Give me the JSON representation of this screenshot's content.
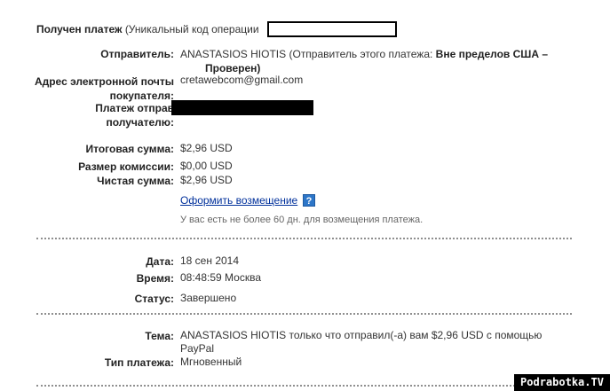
{
  "header": {
    "title_bold": "Получен платеж",
    "title_rest": "(Уникальный код операции"
  },
  "sender": {
    "label": "Отправитель:",
    "name": "ANASTASIOS HIOTIS",
    "status_prefix": "(Отправитель этого платежа:",
    "status_bold_line1": "Вне пределов США –",
    "status_bold_line2": "Проверен)"
  },
  "buyer_email": {
    "label_line1": "Адрес электронной почты",
    "label_line2": "покупателя:",
    "value": "cretawebcom@gmail.com"
  },
  "sent_to": {
    "label_line1": "Платеж отправ",
    "label_line2": "получателю:"
  },
  "amounts": {
    "total_label": "Итоговая сумма:",
    "total_value": "$2,96 USD",
    "fee_label": "Размер комиссии:",
    "fee_value": "$0,00 USD",
    "net_label": "Чистая сумма:",
    "net_value": "$2,96 USD"
  },
  "refund": {
    "link": "Оформить возмещение",
    "help_icon": "?",
    "note": "У вас есть не более 60 дн. для возмещения платежа."
  },
  "details": {
    "date_label": "Дата:",
    "date_value": "18 сен 2014",
    "time_label": "Время:",
    "time_value": "08:48:59 Москва",
    "status_label": "Статус:",
    "status_value": "Завершено"
  },
  "subject": {
    "label": "Тема:",
    "value_line1": "ANASTASIOS HIOTIS только что отправил(-а) вам $2,96 USD с помощью",
    "value_line2": "PayPal",
    "type_label": "Тип платежа:",
    "type_value": "Мгновенный"
  },
  "watermark": "Podrabotka.TV"
}
